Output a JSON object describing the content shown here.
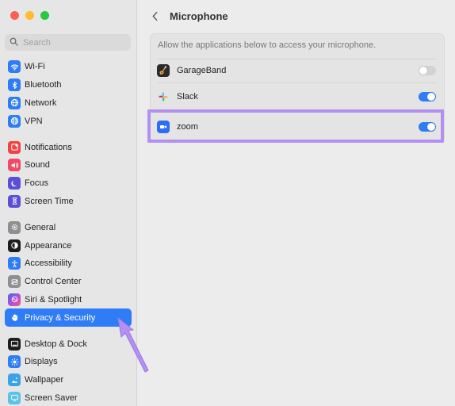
{
  "window": {
    "title": "Microphone"
  },
  "search": {
    "placeholder": "Search"
  },
  "sidebar": {
    "groups": [
      [
        {
          "label": "Wi-Fi",
          "icon": "wifi-icon",
          "color": "#2f7df6"
        },
        {
          "label": "Bluetooth",
          "icon": "bluetooth-icon",
          "color": "#2f7df6"
        },
        {
          "label": "Network",
          "icon": "globe-icon",
          "color": "#2f7df6"
        },
        {
          "label": "VPN",
          "icon": "vpn-globe-icon",
          "color": "#2f7df6"
        }
      ],
      [
        {
          "label": "Notifications",
          "icon": "bell-icon",
          "color": "#f04444"
        },
        {
          "label": "Sound",
          "icon": "speaker-icon",
          "color": "#f04a64"
        },
        {
          "label": "Focus",
          "icon": "moon-icon",
          "color": "#5b4fd8"
        },
        {
          "label": "Screen Time",
          "icon": "hourglass-icon",
          "color": "#5b4fd8"
        }
      ],
      [
        {
          "label": "General",
          "icon": "gear-icon",
          "color": "#8e8e93"
        },
        {
          "label": "Appearance",
          "icon": "appearance-icon",
          "color": "#1d1d1f"
        },
        {
          "label": "Accessibility",
          "icon": "accessibility-icon",
          "color": "#2f7df6"
        },
        {
          "label": "Control Center",
          "icon": "control-center-icon",
          "color": "#8e8e93"
        },
        {
          "label": "Siri & Spotlight",
          "icon": "siri-icon",
          "color": "#7a3fd1"
        },
        {
          "label": "Privacy & Security",
          "icon": "hand-icon",
          "color": "#2f7df6",
          "active": true
        }
      ],
      [
        {
          "label": "Desktop & Dock",
          "icon": "dock-icon",
          "color": "#1d1d1f"
        },
        {
          "label": "Displays",
          "icon": "sun-icon",
          "color": "#2f7df6"
        },
        {
          "label": "Wallpaper",
          "icon": "wallpaper-icon",
          "color": "#3aa3e8"
        },
        {
          "label": "Screen Saver",
          "icon": "screensaver-icon",
          "color": "#5cc2e8"
        }
      ]
    ]
  },
  "main": {
    "description": "Allow the applications below to access your microphone.",
    "apps": [
      {
        "name": "GarageBand",
        "icon": "garageband-icon",
        "enabled": false
      },
      {
        "name": "Slack",
        "icon": "slack-icon",
        "enabled": true
      },
      {
        "name": "zoom",
        "icon": "zoom-icon",
        "enabled": true
      }
    ]
  },
  "colors": {
    "accent": "#2f7df6",
    "highlight": "#b28ff2"
  }
}
